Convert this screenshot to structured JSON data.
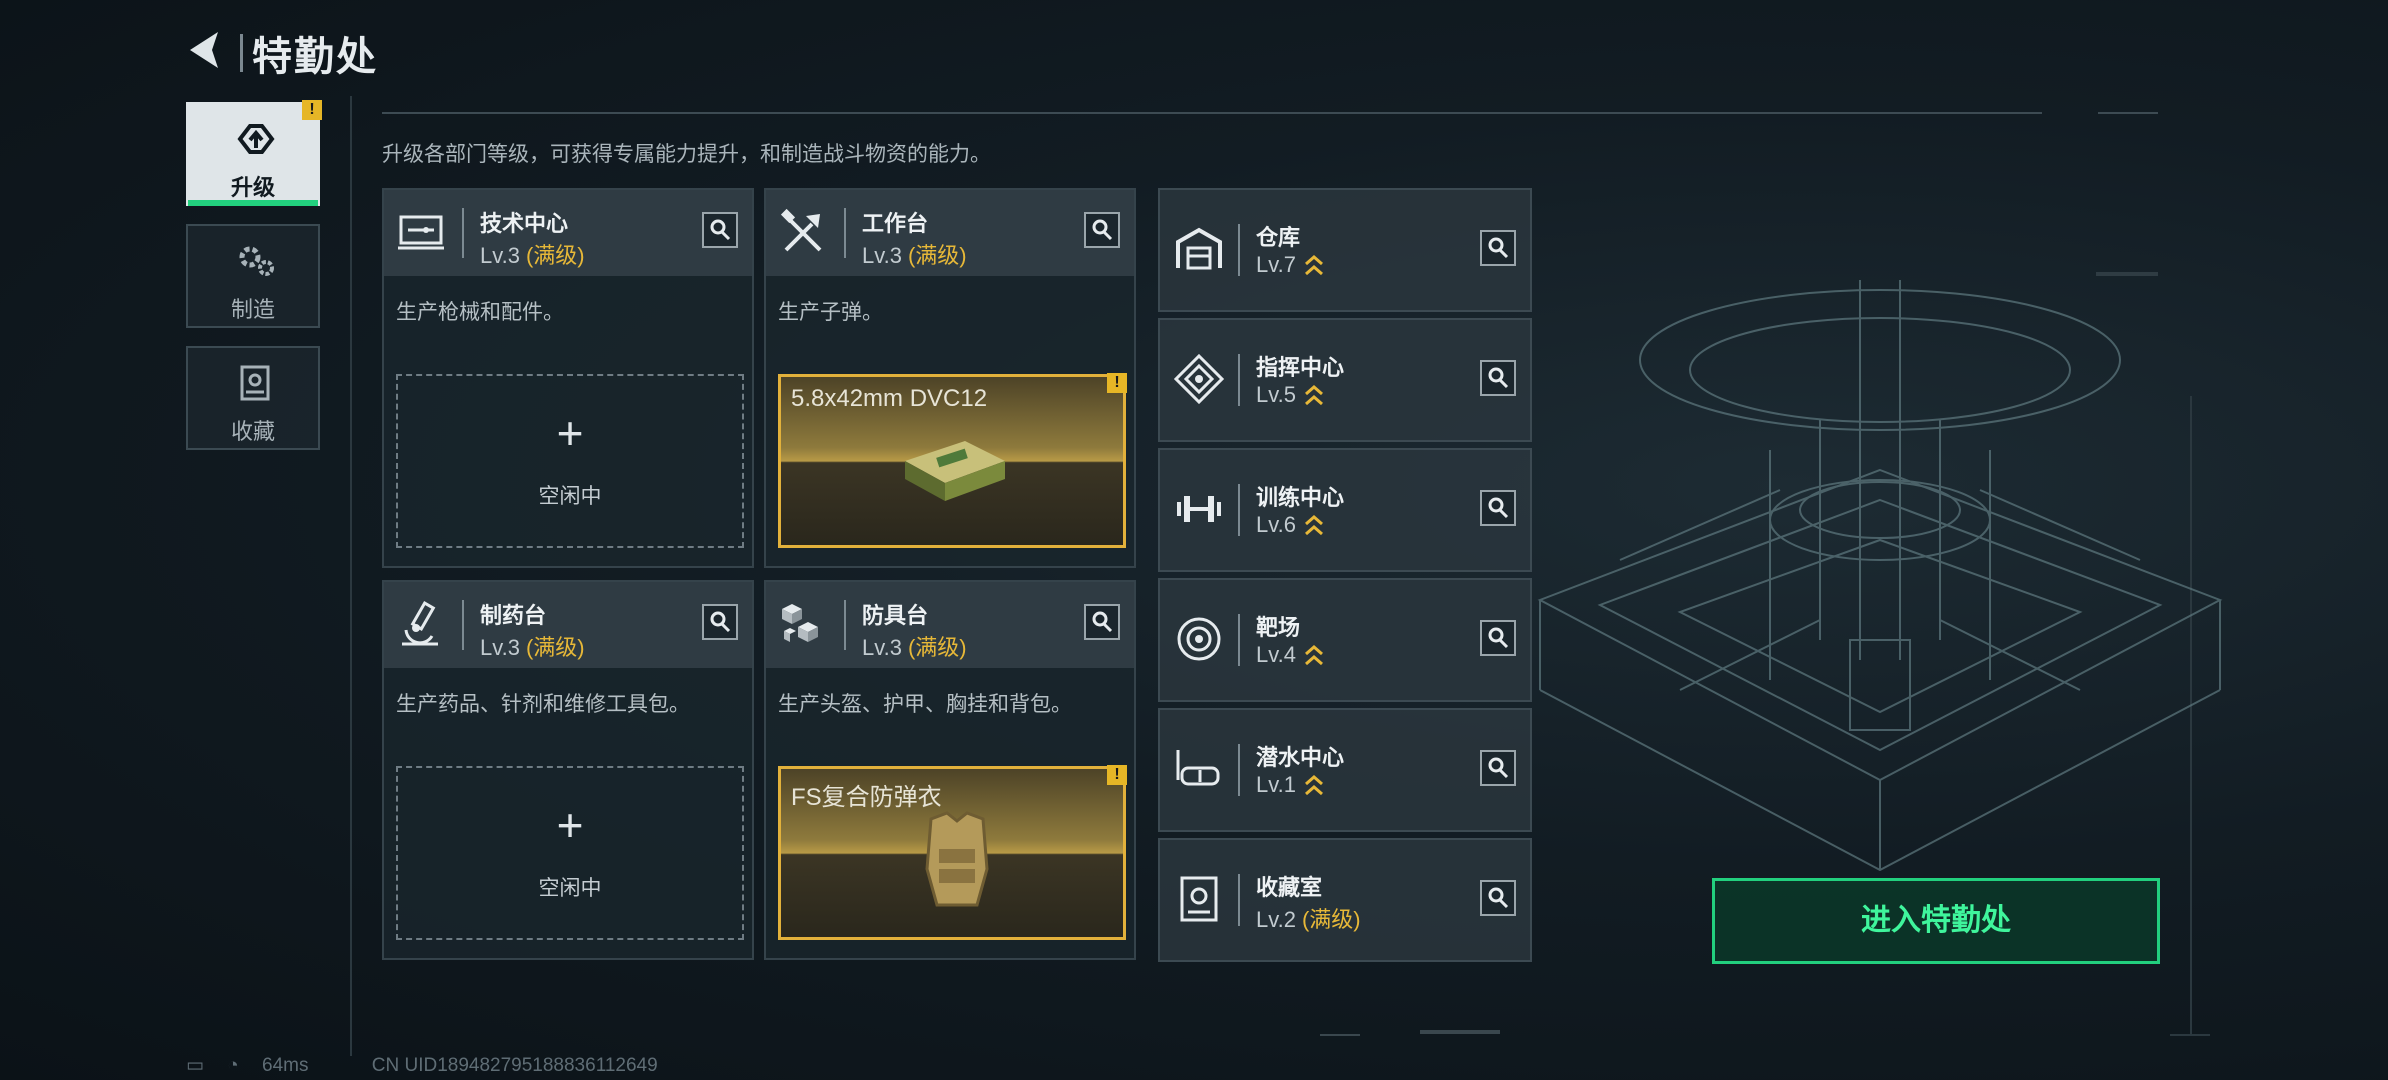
{
  "header": {
    "title": "特勤处"
  },
  "tabs": [
    {
      "label": "升级",
      "icon": "upgrade-icon",
      "active": true,
      "alert": "!"
    },
    {
      "label": "制造",
      "icon": "gear-icon",
      "active": false
    },
    {
      "label": "收藏",
      "icon": "collection-icon",
      "active": false
    }
  ],
  "description": "升级各部门等级，可获得专属能力提升，和制造战斗物资的能力。",
  "big_cards": [
    {
      "name": "技术中心",
      "level": "Lv.3",
      "max": "(满级)",
      "desc": "生产枪械和配件。",
      "slot": {
        "type": "idle",
        "plus": "+",
        "text": "空闲中"
      }
    },
    {
      "name": "工作台",
      "level": "Lv.3",
      "max": "(满级)",
      "desc": "生产子弹。",
      "slot": {
        "type": "item",
        "name": "5.8x42mm DVC12",
        "alert": "!"
      }
    },
    {
      "name": "制药台",
      "level": "Lv.3",
      "max": "(满级)",
      "desc": "生产药品、针剂和维修工具包。",
      "slot": {
        "type": "idle",
        "plus": "+",
        "text": "空闲中"
      }
    },
    {
      "name": "防具台",
      "level": "Lv.3",
      "max": "(满级)",
      "desc": "生产头盔、护甲、胸挂和背包。",
      "slot": {
        "type": "item",
        "name": "FS复合防弹衣",
        "alert": "!"
      }
    }
  ],
  "small_cards": [
    {
      "name": "仓库",
      "level": "Lv.7",
      "upgradable": true
    },
    {
      "name": "指挥中心",
      "level": "Lv.5",
      "upgradable": true
    },
    {
      "name": "训练中心",
      "level": "Lv.6",
      "upgradable": true
    },
    {
      "name": "靶场",
      "level": "Lv.4",
      "upgradable": true
    },
    {
      "name": "潜水中心",
      "level": "Lv.1",
      "upgradable": true
    },
    {
      "name": "收藏室",
      "level": "Lv.2",
      "max": "(满级)",
      "upgradable": false
    }
  ],
  "enter_button": {
    "label": "进入特勤处"
  },
  "status": {
    "ping": "64ms",
    "uid": "CN UID18948279518883611264​9"
  },
  "colors": {
    "accent_green": "#22d07e",
    "gold": "#e7b838",
    "alert_yellow": "#e6b626"
  }
}
